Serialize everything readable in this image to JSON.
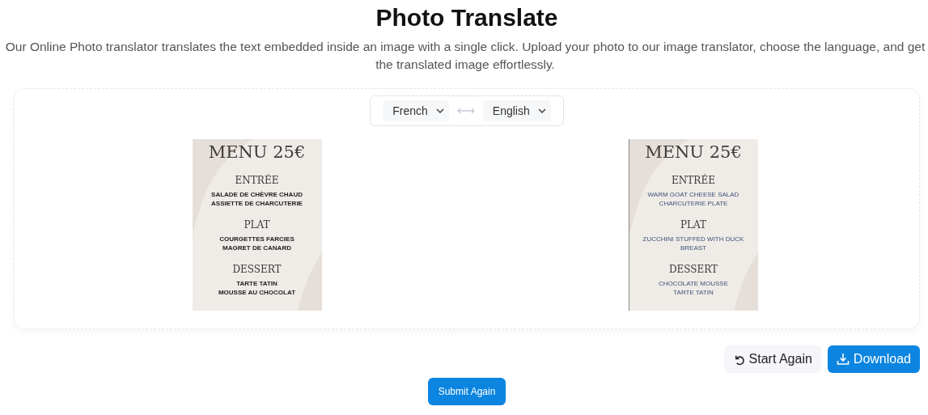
{
  "title": "Photo Translate",
  "description": "Our Online Photo translator translates the text embedded inside an image with a single click. Upload your photo to our image translator, choose the language, and get the translated image effortlessly.",
  "languages": {
    "source": "French",
    "target": "English"
  },
  "menus": [
    {
      "heading": "MENU 25€",
      "sections": [
        {
          "name": "ENTRÉE",
          "items": [
            "SALADE DE CHÈVRE CHAUD",
            "ASSIETTE DE CHARCUTERIE"
          ]
        },
        {
          "name": "PLAT",
          "items": [
            "COURGETTES FARCIES",
            "MAGRET DE CANARD"
          ]
        },
        {
          "name": "DESSERT",
          "items": [
            "TARTE TATIN",
            "MOUSSE AU CHOCOLAT"
          ]
        }
      ]
    },
    {
      "heading": "MENU 25€",
      "sections": [
        {
          "name": "ENTRÉE",
          "items": [
            "WARM GOAT CHEESE SALAD",
            "CHARCUTERIE PLATE"
          ]
        },
        {
          "name": "PLAT",
          "items": [
            "ZUCCHINI STUFFED WITH DUCK",
            "BREAST"
          ]
        },
        {
          "name": "DESSERT",
          "items": [
            "CHOCOLATE MOUSSE",
            "TARTE TATIN"
          ]
        }
      ]
    }
  ],
  "actions": {
    "start_again": "Start Again",
    "download": "Download"
  },
  "submit": "Submit Again"
}
